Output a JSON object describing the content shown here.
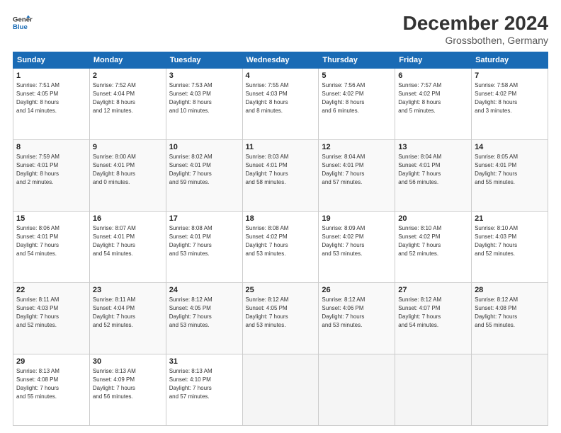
{
  "header": {
    "logo_line1": "General",
    "logo_line2": "Blue",
    "month": "December 2024",
    "location": "Grossbothen, Germany"
  },
  "days_of_week": [
    "Sunday",
    "Monday",
    "Tuesday",
    "Wednesday",
    "Thursday",
    "Friday",
    "Saturday"
  ],
  "weeks": [
    [
      {
        "day": 1,
        "sunrise": "7:51 AM",
        "sunset": "4:05 PM",
        "daylight": "8 hours and 14 minutes."
      },
      {
        "day": 2,
        "sunrise": "7:52 AM",
        "sunset": "4:04 PM",
        "daylight": "8 hours and 12 minutes."
      },
      {
        "day": 3,
        "sunrise": "7:53 AM",
        "sunset": "4:03 PM",
        "daylight": "8 hours and 10 minutes."
      },
      {
        "day": 4,
        "sunrise": "7:55 AM",
        "sunset": "4:03 PM",
        "daylight": "8 hours and 8 minutes."
      },
      {
        "day": 5,
        "sunrise": "7:56 AM",
        "sunset": "4:02 PM",
        "daylight": "8 hours and 6 minutes."
      },
      {
        "day": 6,
        "sunrise": "7:57 AM",
        "sunset": "4:02 PM",
        "daylight": "8 hours and 5 minutes."
      },
      {
        "day": 7,
        "sunrise": "7:58 AM",
        "sunset": "4:02 PM",
        "daylight": "8 hours and 3 minutes."
      }
    ],
    [
      {
        "day": 8,
        "sunrise": "7:59 AM",
        "sunset": "4:01 PM",
        "daylight": "8 hours and 2 minutes."
      },
      {
        "day": 9,
        "sunrise": "8:00 AM",
        "sunset": "4:01 PM",
        "daylight": "8 hours and 0 minutes."
      },
      {
        "day": 10,
        "sunrise": "8:02 AM",
        "sunset": "4:01 PM",
        "daylight": "7 hours and 59 minutes."
      },
      {
        "day": 11,
        "sunrise": "8:03 AM",
        "sunset": "4:01 PM",
        "daylight": "7 hours and 58 minutes."
      },
      {
        "day": 12,
        "sunrise": "8:04 AM",
        "sunset": "4:01 PM",
        "daylight": "7 hours and 57 minutes."
      },
      {
        "day": 13,
        "sunrise": "8:04 AM",
        "sunset": "4:01 PM",
        "daylight": "7 hours and 56 minutes."
      },
      {
        "day": 14,
        "sunrise": "8:05 AM",
        "sunset": "4:01 PM",
        "daylight": "7 hours and 55 minutes."
      }
    ],
    [
      {
        "day": 15,
        "sunrise": "8:06 AM",
        "sunset": "4:01 PM",
        "daylight": "7 hours and 54 minutes."
      },
      {
        "day": 16,
        "sunrise": "8:07 AM",
        "sunset": "4:01 PM",
        "daylight": "7 hours and 54 minutes."
      },
      {
        "day": 17,
        "sunrise": "8:08 AM",
        "sunset": "4:01 PM",
        "daylight": "7 hours and 53 minutes."
      },
      {
        "day": 18,
        "sunrise": "8:08 AM",
        "sunset": "4:02 PM",
        "daylight": "7 hours and 53 minutes."
      },
      {
        "day": 19,
        "sunrise": "8:09 AM",
        "sunset": "4:02 PM",
        "daylight": "7 hours and 53 minutes."
      },
      {
        "day": 20,
        "sunrise": "8:10 AM",
        "sunset": "4:02 PM",
        "daylight": "7 hours and 52 minutes."
      },
      {
        "day": 21,
        "sunrise": "8:10 AM",
        "sunset": "4:03 PM",
        "daylight": "7 hours and 52 minutes."
      }
    ],
    [
      {
        "day": 22,
        "sunrise": "8:11 AM",
        "sunset": "4:03 PM",
        "daylight": "7 hours and 52 minutes."
      },
      {
        "day": 23,
        "sunrise": "8:11 AM",
        "sunset": "4:04 PM",
        "daylight": "7 hours and 52 minutes."
      },
      {
        "day": 24,
        "sunrise": "8:12 AM",
        "sunset": "4:05 PM",
        "daylight": "7 hours and 53 minutes."
      },
      {
        "day": 25,
        "sunrise": "8:12 AM",
        "sunset": "4:05 PM",
        "daylight": "7 hours and 53 minutes."
      },
      {
        "day": 26,
        "sunrise": "8:12 AM",
        "sunset": "4:06 PM",
        "daylight": "7 hours and 53 minutes."
      },
      {
        "day": 27,
        "sunrise": "8:12 AM",
        "sunset": "4:07 PM",
        "daylight": "7 hours and 54 minutes."
      },
      {
        "day": 28,
        "sunrise": "8:12 AM",
        "sunset": "4:08 PM",
        "daylight": "7 hours and 55 minutes."
      }
    ],
    [
      {
        "day": 29,
        "sunrise": "8:13 AM",
        "sunset": "4:08 PM",
        "daylight": "7 hours and 55 minutes."
      },
      {
        "day": 30,
        "sunrise": "8:13 AM",
        "sunset": "4:09 PM",
        "daylight": "7 hours and 56 minutes."
      },
      {
        "day": 31,
        "sunrise": "8:13 AM",
        "sunset": "4:10 PM",
        "daylight": "7 hours and 57 minutes."
      },
      null,
      null,
      null,
      null
    ]
  ]
}
